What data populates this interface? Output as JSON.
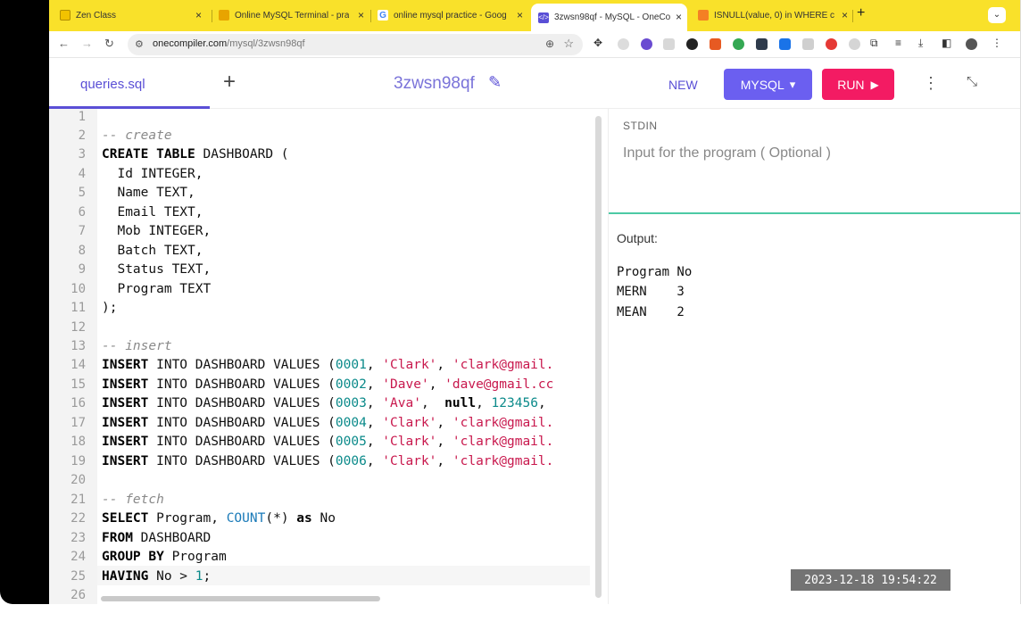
{
  "browser": {
    "tabs": [
      {
        "title": "Zen Class",
        "close": ""
      },
      {
        "title": "Online MySQL Terminal - pra",
        "close": "×"
      },
      {
        "title": "online mysql practice - Goog",
        "close": "×"
      },
      {
        "title": "3zwsn98qf - MySQL - OneCo",
        "close": "×"
      },
      {
        "title": "ISNULL(value, 0) in WHERE c",
        "close": "×"
      }
    ],
    "new_tab": "+",
    "tab_dropdown": "⌄",
    "address": {
      "host": "onecompiler.com",
      "path": "/mysql/3zwsn98qf"
    },
    "nav": {
      "back": "←",
      "forward": "→",
      "reload": "↻"
    }
  },
  "app": {
    "file_tab": "queries.sql",
    "add_file": "+",
    "project_name": "3zwsn98qf",
    "new_label": "NEW",
    "language_label": "MYSQL",
    "language_chevron": "▾",
    "run_label": "RUN",
    "run_icon": "▶",
    "accent": "#5a4fd6",
    "run_color": "#f31b63"
  },
  "editor": {
    "line_numbers": [
      "1",
      "2",
      "3",
      "4",
      "5",
      "6",
      "7",
      "8",
      "9",
      "10",
      "11",
      "12",
      "13",
      "14",
      "15",
      "16",
      "17",
      "18",
      "19",
      "20",
      "21",
      "22",
      "23",
      "24",
      "25",
      "26"
    ]
  },
  "stdin": {
    "label": "STDIN",
    "placeholder": "Input for the program ( Optional )"
  },
  "output": {
    "label": "Output:",
    "lines": [
      "Program No",
      "MERN    3",
      "MEAN    2"
    ]
  },
  "timestamp": "2023-12-18 19:54:22"
}
